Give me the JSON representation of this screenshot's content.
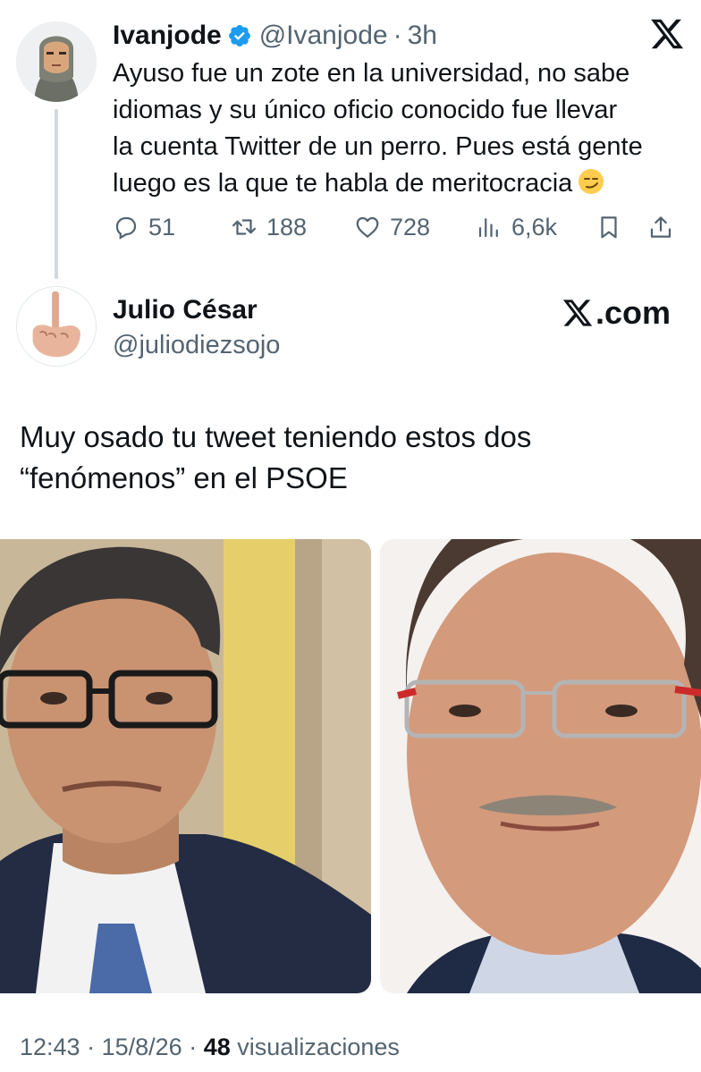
{
  "original_tweet": {
    "author_name": "Ivanjode",
    "handle": "@Ivanjode",
    "separator": "·",
    "time": "3h",
    "text_lines": [
      "Ayuso fue un zote en la universidad, no sabe",
      "idiomas y su único oficio conocido fue llevar",
      "la cuenta Twitter de un perro. Pues está gente",
      "luego es la que te habla de meritocracia"
    ],
    "emoji": "smirking-face-emoji",
    "metrics": {
      "replies": "51",
      "reposts": "188",
      "likes": "728",
      "views": "6,6k"
    }
  },
  "reply_tweet": {
    "author_name": "Julio César",
    "handle": "@juliodiezsojo",
    "brand": ".com",
    "text_lines": [
      "Muy osado tu tweet teniendo estos dos",
      "“fenómenos” en el PSOE"
    ],
    "images": [
      {
        "name": "photo-left"
      },
      {
        "name": "photo-right"
      }
    ]
  },
  "footer": {
    "time": "12:43",
    "sep1": "·",
    "date": "15/8/26",
    "sep2": "·",
    "views_count": "48",
    "views_label": "visualizaciones"
  },
  "colors": {
    "text": "#0f1419",
    "secondary": "#536471",
    "verified": "#1d9bf0",
    "thread_line": "#cfd9de"
  },
  "icons": [
    "x-logo-icon",
    "verified-badge-icon",
    "reply-icon",
    "repost-icon",
    "like-icon",
    "views-icon",
    "bookmark-icon",
    "share-icon"
  ]
}
